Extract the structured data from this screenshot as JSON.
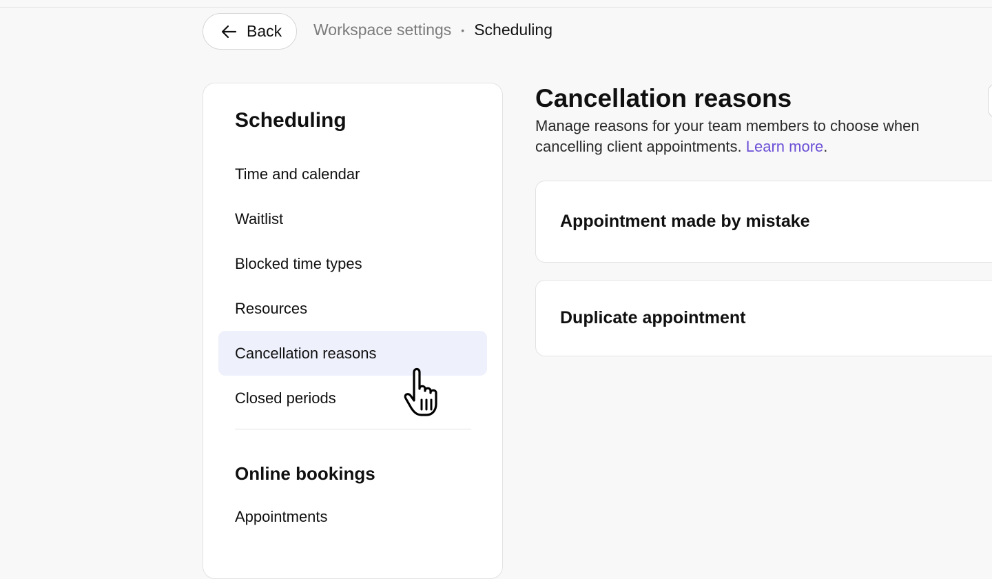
{
  "header": {
    "back_label": "Back",
    "breadcrumb": {
      "parent": "Workspace settings",
      "separator": "•",
      "current": "Scheduling"
    }
  },
  "sidebar": {
    "sections": [
      {
        "heading": "Scheduling",
        "items": [
          {
            "label": "Time and calendar",
            "active": false
          },
          {
            "label": "Waitlist",
            "active": false
          },
          {
            "label": "Blocked time types",
            "active": false
          },
          {
            "label": "Resources",
            "active": false
          },
          {
            "label": "Cancellation reasons",
            "active": true
          },
          {
            "label": "Closed periods",
            "active": false
          }
        ]
      },
      {
        "heading": "Online bookings",
        "items": [
          {
            "label": "Appointments",
            "active": false
          }
        ]
      }
    ]
  },
  "main": {
    "title": "Cancellation reasons",
    "description": "Manage reasons for your team members to choose when cancelling client appointments.",
    "learn_more": "Learn more",
    "description_end": ".",
    "reasons": [
      {
        "label": "Appointment made by mistake"
      },
      {
        "label": "Duplicate appointment"
      }
    ]
  },
  "colors": {
    "accent": "#6b4fd6",
    "active_item_bg": "#eef0fc",
    "page_bg": "#f8f8f8"
  },
  "icons": {
    "back": "arrow-left-icon",
    "cursor": "hand-pointer-cursor"
  }
}
